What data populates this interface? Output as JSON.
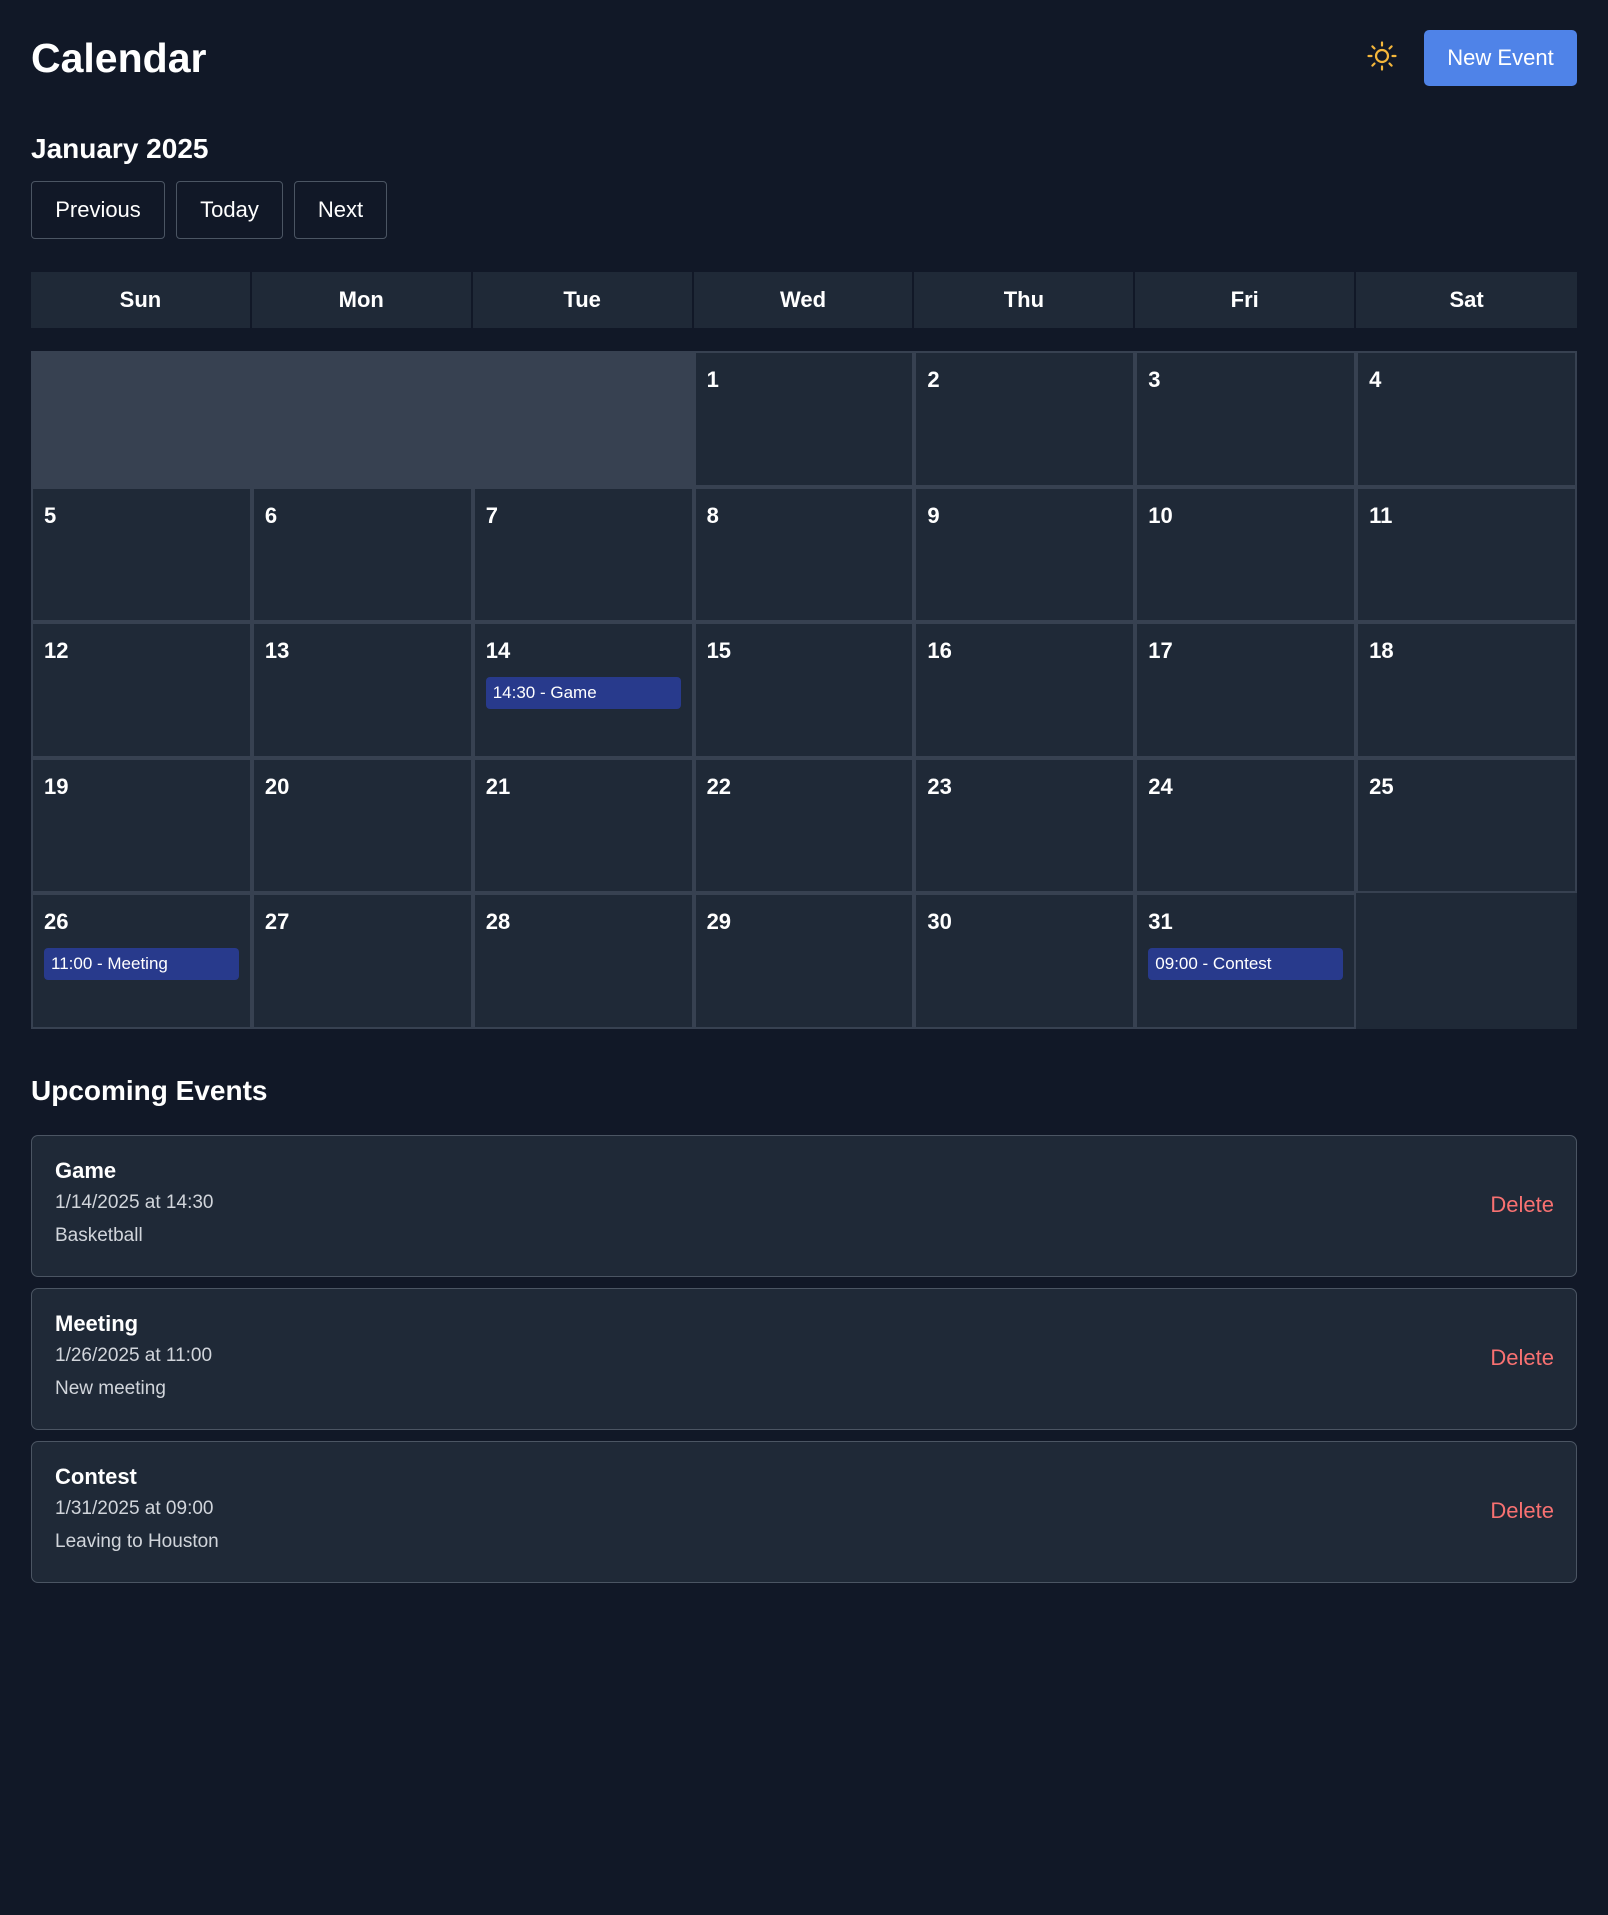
{
  "header": {
    "title": "Calendar",
    "theme_icon": "sun-icon",
    "new_event_label": "New Event",
    "accent_color": "#4f83e8"
  },
  "month": {
    "title": "January 2025",
    "prev_label": "Previous",
    "today_label": "Today",
    "next_label": "Next"
  },
  "weekdays": [
    "Sun",
    "Mon",
    "Tue",
    "Wed",
    "Thu",
    "Fri",
    "Sat"
  ],
  "calendar": {
    "leading_empty": 3,
    "trailing_empty": 1,
    "days": [
      {
        "day": "1",
        "events": []
      },
      {
        "day": "2",
        "events": []
      },
      {
        "day": "3",
        "events": []
      },
      {
        "day": "4",
        "events": []
      },
      {
        "day": "5",
        "events": []
      },
      {
        "day": "6",
        "events": []
      },
      {
        "day": "7",
        "events": []
      },
      {
        "day": "8",
        "events": []
      },
      {
        "day": "9",
        "events": []
      },
      {
        "day": "10",
        "events": []
      },
      {
        "day": "11",
        "events": []
      },
      {
        "day": "12",
        "events": []
      },
      {
        "day": "13",
        "events": []
      },
      {
        "day": "14",
        "events": [
          "14:30 - Game"
        ]
      },
      {
        "day": "15",
        "events": []
      },
      {
        "day": "16",
        "events": []
      },
      {
        "day": "17",
        "events": []
      },
      {
        "day": "18",
        "events": []
      },
      {
        "day": "19",
        "events": []
      },
      {
        "day": "20",
        "events": []
      },
      {
        "day": "21",
        "events": []
      },
      {
        "day": "22",
        "events": []
      },
      {
        "day": "23",
        "events": []
      },
      {
        "day": "24",
        "events": []
      },
      {
        "day": "25",
        "events": []
      },
      {
        "day": "26",
        "events": [
          "11:00 - Meeting"
        ]
      },
      {
        "day": "27",
        "events": []
      },
      {
        "day": "28",
        "events": []
      },
      {
        "day": "29",
        "events": []
      },
      {
        "day": "30",
        "events": []
      },
      {
        "day": "31",
        "events": [
          "09:00 - Contest"
        ]
      }
    ]
  },
  "upcoming": {
    "title": "Upcoming Events",
    "events": [
      {
        "name": "Game",
        "when": "1/14/2025 at 14:30",
        "description": "Basketball",
        "delete_label": "Delete"
      },
      {
        "name": "Meeting",
        "when": "1/26/2025 at 11:00",
        "description": "New meeting",
        "delete_label": "Delete"
      },
      {
        "name": "Contest",
        "when": "1/31/2025 at 09:00",
        "description": "Leaving to Houston",
        "delete_label": "Delete"
      }
    ]
  }
}
